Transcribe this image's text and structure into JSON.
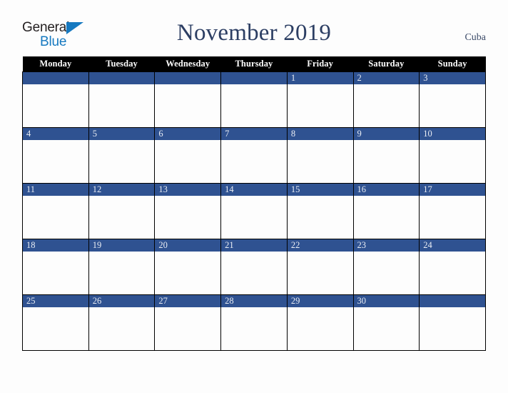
{
  "brand": {
    "name_part1": "General",
    "name_part2": "Blue",
    "triangle_color": "#1679c0",
    "text_color": "#231f20"
  },
  "header": {
    "title": "November 2019",
    "month": "November",
    "year": "2019",
    "region": "Cuba",
    "title_color": "#2c3e63"
  },
  "calendar": {
    "header_background": "#000000",
    "header_text_color": "#ffffff",
    "date_bar_color": "#2f5291",
    "date_text_color": "#e9edf4",
    "cell_background": "#fdfdfd",
    "grid_line_color": "#000000",
    "weekday_headers": [
      "Monday",
      "Tuesday",
      "Wednesday",
      "Thursday",
      "Friday",
      "Saturday",
      "Sunday"
    ],
    "weeks": [
      [
        {
          "date": ""
        },
        {
          "date": ""
        },
        {
          "date": ""
        },
        {
          "date": ""
        },
        {
          "date": "1"
        },
        {
          "date": "2"
        },
        {
          "date": "3"
        }
      ],
      [
        {
          "date": "4"
        },
        {
          "date": "5"
        },
        {
          "date": "6"
        },
        {
          "date": "7"
        },
        {
          "date": "8"
        },
        {
          "date": "9"
        },
        {
          "date": "10"
        }
      ],
      [
        {
          "date": "11"
        },
        {
          "date": "12"
        },
        {
          "date": "13"
        },
        {
          "date": "14"
        },
        {
          "date": "15"
        },
        {
          "date": "16"
        },
        {
          "date": "17"
        }
      ],
      [
        {
          "date": "18"
        },
        {
          "date": "19"
        },
        {
          "date": "20"
        },
        {
          "date": "21"
        },
        {
          "date": "22"
        },
        {
          "date": "23"
        },
        {
          "date": "24"
        }
      ],
      [
        {
          "date": "25"
        },
        {
          "date": "26"
        },
        {
          "date": "27"
        },
        {
          "date": "28"
        },
        {
          "date": "29"
        },
        {
          "date": "30"
        },
        {
          "date": ""
        }
      ]
    ]
  }
}
